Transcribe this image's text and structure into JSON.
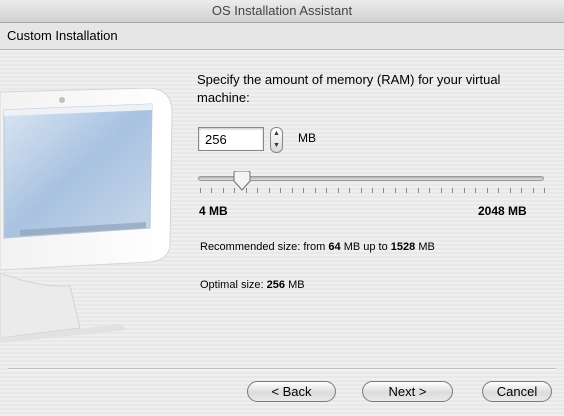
{
  "window": {
    "title": "OS Installation Assistant"
  },
  "section": {
    "title": "Custom Installation"
  },
  "memory": {
    "prompt": "Specify the amount of memory (RAM) for your virtual machine:",
    "value": "256",
    "unit": "MB",
    "slider_min_label": "4 MB",
    "slider_max_label": "2048 MB",
    "slider_min": 4,
    "slider_max": 2048,
    "slider_value": 256,
    "recommended_prefix": "Recommended size: from",
    "recommended_min": "64",
    "recommended_mid": "MB up to",
    "recommended_max": "1528",
    "recommended_suffix": "MB",
    "optimal_prefix": "Optimal size:",
    "optimal_value": "256",
    "optimal_suffix": "MB"
  },
  "buttons": {
    "back": "< Back",
    "next": "Next >",
    "cancel": "Cancel"
  }
}
